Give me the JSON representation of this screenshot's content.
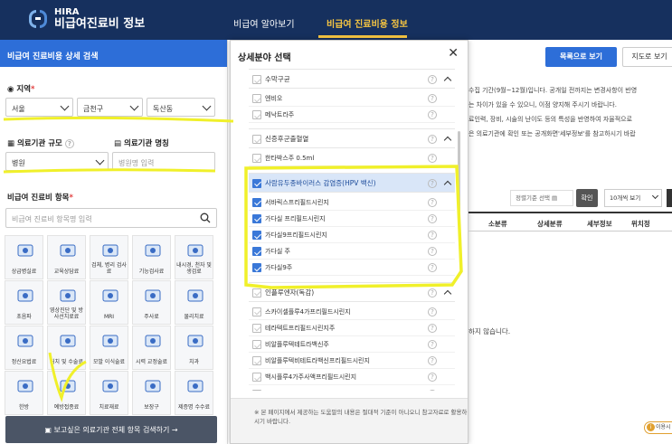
{
  "header": {
    "logo_top": "HIRA",
    "logo_bottom": "비급여진료비 정보",
    "nav": [
      {
        "label": "비급여 알아보기",
        "active": false
      },
      {
        "label": "비급여 진료비용 정보",
        "active": true
      }
    ]
  },
  "left": {
    "title": "비급여 진료비용 상세 검색",
    "region": {
      "label": "지역",
      "sido": "서울",
      "sigungu": "금천구",
      "dong": "독산동"
    },
    "scale": {
      "label": "의료기관 규모",
      "value": "병원"
    },
    "inst_name": {
      "label": "의료기관 명칭",
      "placeholder": "병원명 입력"
    },
    "items": {
      "label": "비급여 진료비 항목",
      "placeholder": "비급여 진료비 항목명 입력"
    },
    "categories": [
      "상급병실료",
      "교육상담료",
      "검체, 병리 검사료",
      "기능검사료",
      "내시경, 천자 및 생검료",
      "초음파",
      "영상진단 및 방사선치료료",
      "MRI",
      "주사료",
      "물리치료",
      "정신요법료",
      "처치 및 수술료",
      "모발 이식술료",
      "시력 교정술료",
      "치과",
      "한방",
      "예방접종료",
      "치료재료",
      "보장구",
      "제증명 수수료"
    ],
    "bottom_button": "보고싶은 의료기관 전체 항목 검색하기 →"
  },
  "modal": {
    "title": "상세분야 선택",
    "close": "✕",
    "rows": [
      {
        "type": "group",
        "text": "수막구균",
        "checked": false,
        "hl": false
      },
      {
        "type": "child",
        "text": "엔비오",
        "checked": false
      },
      {
        "type": "child",
        "text": "메낙트라주",
        "checked": false
      },
      {
        "type": "group",
        "text": "신증후군출혈열",
        "checked": false,
        "hl": false
      },
      {
        "type": "child",
        "text": "한타박스주 0.5ml",
        "checked": false
      },
      {
        "type": "group",
        "text": "사람유두종바이러스 감염증(HPV 백신)",
        "checked": true,
        "hl": true
      },
      {
        "type": "child",
        "text": "서바릭스프리필드시린지",
        "checked": true
      },
      {
        "type": "child",
        "text": "가다실 프리필드시린지",
        "checked": true
      },
      {
        "type": "child",
        "text": "가다실9프리필드시린지",
        "checked": true
      },
      {
        "type": "child",
        "text": "가다실 주",
        "checked": true
      },
      {
        "type": "child",
        "text": "가다실9주",
        "checked": true
      },
      {
        "type": "group",
        "text": "인플루엔자(독감)",
        "checked": false,
        "hl": false
      },
      {
        "type": "child",
        "text": "스카이셀플루4가프리필드시린지",
        "checked": false
      },
      {
        "type": "child",
        "text": "테라텍트프리필드시린지주",
        "checked": false
      },
      {
        "type": "child",
        "text": "비알플루텍테트라백신주",
        "checked": false
      },
      {
        "type": "child",
        "text": "비알플루텍비테트라백신프리필드시린지",
        "checked": false
      },
      {
        "type": "child",
        "text": "백시플루4가주사액프리필드시린지",
        "checked": false
      },
      {
        "type": "child",
        "text": "지씨플루쿼드리밸런트프리필드시린지주",
        "checked": false
      },
      {
        "type": "child",
        "text": "코박스플루4가PF주",
        "checked": false
      },
      {
        "type": "child",
        "text": "비알플루텍테트라백신주",
        "checked": false
      }
    ],
    "footer": "※ 본 페이지에서 제공하는 도움말의 내용은 절대적 기준이 아니오니 참고자료로 활용하시기 바랍니다."
  },
  "right": {
    "list_button": "목록으로 보기",
    "map_button": "지도로 보기",
    "notice_lines": [
      "수집 기간(9월~12월)입니다. 공개일 전까지는 변경사항이 반영",
      "는 차이가 있을 수 있으니, 이점 양지해 주시기 바랍니다.",
      "료인력, 장비, 시술의 난이도 등의 특성을 반영하여 자율적으로",
      "은 의료기관에 확인 또는 공개화면'세부정보'를 참고하시기 바랍"
    ],
    "sort_label": "정렬기준 선택",
    "confirm": "확인",
    "per_page": "10개씩 보기",
    "columns": [
      "소분류",
      "상세분류",
      "세부정보",
      "위치정"
    ],
    "no_data": "하지 않습니다.",
    "badge": "이용시"
  },
  "colors": {
    "header_bg": "#16305e",
    "accent": "#2d6ed8",
    "nav_active": "#f5c542",
    "highlight_marker": "#f0f02a"
  }
}
